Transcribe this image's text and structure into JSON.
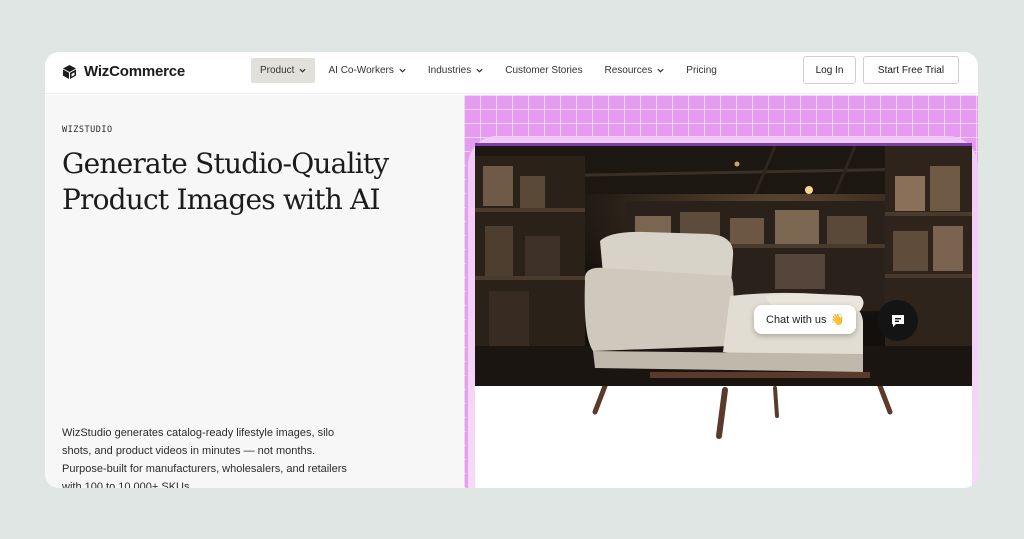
{
  "header": {
    "logo_text": "WizCommerce",
    "nav": [
      {
        "label": "Product",
        "has_dropdown": true,
        "active": true
      },
      {
        "label": "AI Co-Workers",
        "has_dropdown": true
      },
      {
        "label": "Industries",
        "has_dropdown": true
      },
      {
        "label": "Customer Stories",
        "has_dropdown": false
      },
      {
        "label": "Resources",
        "has_dropdown": true
      },
      {
        "label": "Pricing",
        "has_dropdown": false
      }
    ],
    "login_label": "Log In",
    "trial_label": "Start Free Trial"
  },
  "hero": {
    "eyebrow": "WIZSTUDIO",
    "headline_line1": "Generate Studio-Quality",
    "headline_line2": "Product Images with AI",
    "description": "WizStudio generates catalog-ready lifestyle images, silo shots, and product videos in minutes — not months. Purpose-built for manufacturers, wholesalers, and retailers with 100 to 10,000+ SKUs."
  },
  "chat": {
    "label": "Chat with us",
    "emoji": "👋"
  },
  "colors": {
    "background": "#dfe6e3",
    "accent_pink": "#e59cf0",
    "active_nav": "#e2e0da"
  },
  "icons": [
    "logo-cube-icon",
    "chevron-down-icon",
    "chat-bubble-icon",
    "waving-hand-icon"
  ]
}
